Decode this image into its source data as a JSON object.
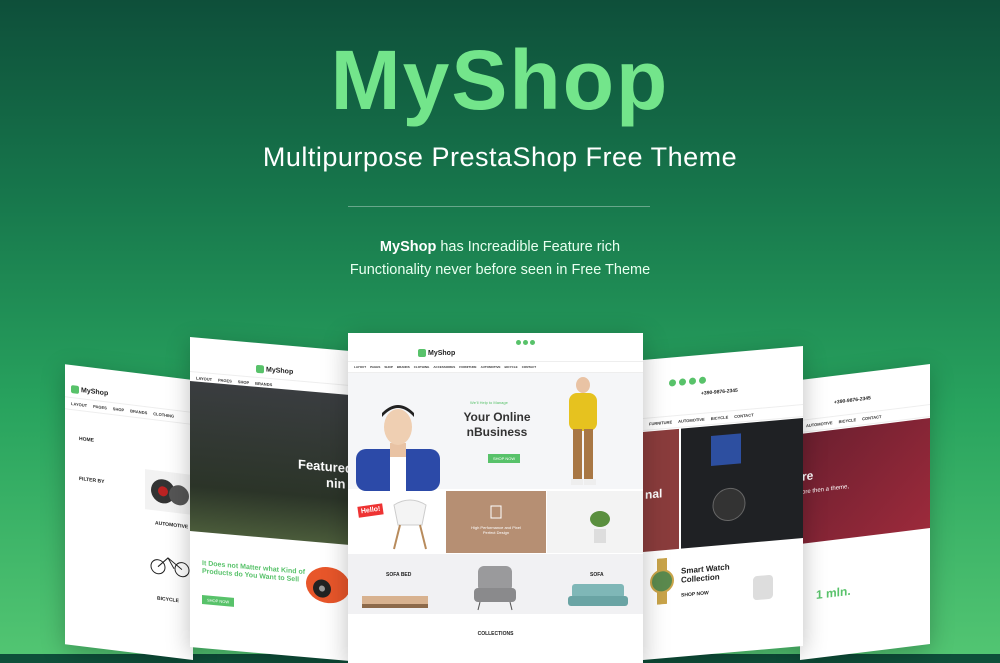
{
  "hero": {
    "brand": "MyShop",
    "subtitle": "Multipurpose PrestaShop Free Theme",
    "tagline_bold": "MyShop",
    "tagline_rest": " has Increadible Feature rich",
    "tagline_line2": "Functionality never before seen in Free Theme"
  },
  "center_shot": {
    "logo": "MyShop",
    "nav": [
      "LAYOUT",
      "PAGES",
      "SHOP",
      "BRANDS",
      "CLOTHING",
      "ACCESSORIES",
      "FURNITURE",
      "AUTOMOTIVE",
      "BICYCLE",
      "CONTACT"
    ],
    "small": "We'll Help to Manage",
    "headline1": "Your Online",
    "headline2": "nBusiness",
    "shop_now": "SHOP NOW",
    "tile2": "High Performance and Pixel Perfect Design",
    "hello": "Hello!",
    "sofa_bed": "SOFA BED",
    "sofa": "SOFA",
    "collections": "COLLECTIONS"
  },
  "left_shot_2": {
    "logo": "MyShop",
    "nav": [
      "LAYOUT",
      "PAGES",
      "SHOP",
      "BRANDS"
    ],
    "hero_text": "Featured",
    "hero_text2": "nin",
    "promo": "It Does not Matter what Kind of Products do You Want to Sell",
    "btn": "SHOP NOW"
  },
  "left_shot_1": {
    "logo": "MyShop",
    "nav": [
      "LAYOUT",
      "PAGES",
      "SHOP",
      "BRANDS",
      "CLOTHING"
    ],
    "home": "HOME",
    "automotive": "AUTOMOTIVE",
    "bicycle": "BICYCLE",
    "filter": "FILTER BY"
  },
  "right_shot_1": {
    "phone": "+390-9876-2345",
    "nav": [
      "FURNITURE",
      "AUTOMOTIVE",
      "BICYCLE",
      "CONTACT"
    ],
    "hero_text": "nal",
    "smart": "Smart Watch",
    "collection": "Collection",
    "btn": "SHOP NOW"
  },
  "right_shot_2": {
    "phone": "+390-9876-2345",
    "nav": [
      "AUTOMOTIVE",
      "BICYCLE",
      "CONTACT"
    ],
    "hero_text": "re",
    "hero_sub": "ore then a theme,",
    "million": "1 mln."
  }
}
